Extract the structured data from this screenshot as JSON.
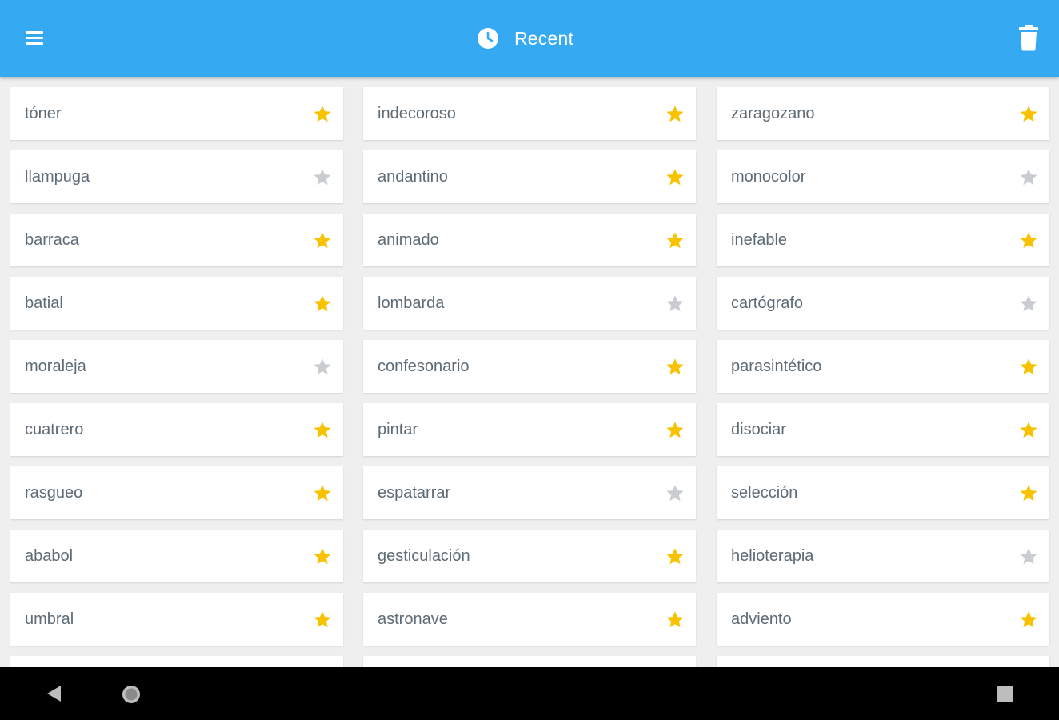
{
  "header": {
    "title": "Recent",
    "left_icon": "menu-icon",
    "title_icon": "clock-icon",
    "right_icon": "trash-icon"
  },
  "colors": {
    "appbar": "#35a9f1",
    "star_on": "#f8c200",
    "star_off": "#c9cdd1",
    "word_text": "#5d6b76"
  },
  "words": [
    {
      "text": "tóner",
      "favorite": true
    },
    {
      "text": "indecoroso",
      "favorite": true
    },
    {
      "text": "zaragozano",
      "favorite": true
    },
    {
      "text": "llampuga",
      "favorite": false
    },
    {
      "text": "andantino",
      "favorite": true
    },
    {
      "text": "monocolor",
      "favorite": false
    },
    {
      "text": "barraca",
      "favorite": true
    },
    {
      "text": "animado",
      "favorite": true
    },
    {
      "text": "inefable",
      "favorite": true
    },
    {
      "text": "batial",
      "favorite": true
    },
    {
      "text": "lombarda",
      "favorite": false
    },
    {
      "text": "cartógrafo",
      "favorite": false
    },
    {
      "text": "moraleja",
      "favorite": false
    },
    {
      "text": "confesonario",
      "favorite": true
    },
    {
      "text": "parasintético",
      "favorite": true
    },
    {
      "text": "cuatrero",
      "favorite": true
    },
    {
      "text": "pintar",
      "favorite": true
    },
    {
      "text": "disociar",
      "favorite": true
    },
    {
      "text": "rasgueo",
      "favorite": true
    },
    {
      "text": "espatarrar",
      "favorite": false
    },
    {
      "text": "selección",
      "favorite": true
    },
    {
      "text": "ababol",
      "favorite": true
    },
    {
      "text": "gesticulación",
      "favorite": true
    },
    {
      "text": "helioterapia",
      "favorite": false
    },
    {
      "text": "umbral",
      "favorite": true
    },
    {
      "text": "astronave",
      "favorite": true
    },
    {
      "text": "adviento",
      "favorite": true
    },
    {
      "text": "",
      "favorite": false
    },
    {
      "text": "",
      "favorite": false
    },
    {
      "text": "",
      "favorite": false
    }
  ],
  "navbar": {
    "back_icon": "back-triangle-icon",
    "home_icon": "home-circle-icon",
    "recents_icon": "recents-square-icon"
  }
}
